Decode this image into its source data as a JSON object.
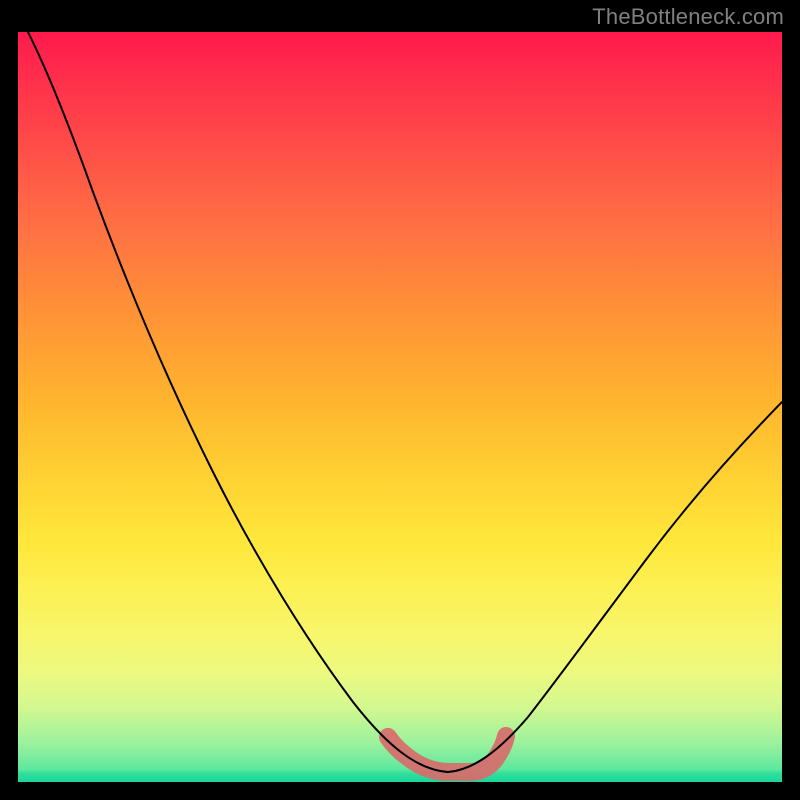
{
  "watermark": "TheBottleneck.com",
  "colors": {
    "frame_bg": "#000000",
    "curve_stroke": "#000000",
    "highlight_stroke": "#d86b6b",
    "gradient_top": "#ff1a4d",
    "gradient_bottom": "#17d79a"
  },
  "chart_data": {
    "type": "line",
    "title": "",
    "xlabel": "",
    "ylabel": "",
    "xlim": [
      0,
      100
    ],
    "ylim": [
      0,
      100
    ],
    "grid": false,
    "legend": false,
    "series": [
      {
        "name": "left-curve",
        "x": [
          0,
          3,
          7,
          12,
          18,
          24,
          30,
          36,
          42,
          46,
          50,
          53,
          56
        ],
        "y": [
          100,
          94,
          85,
          74,
          62,
          51,
          40,
          29,
          18,
          11,
          5,
          2,
          1
        ]
      },
      {
        "name": "right-curve",
        "x": [
          56,
          59,
          63,
          68,
          74,
          80,
          86,
          92,
          97,
          100
        ],
        "y": [
          1,
          2,
          5,
          10,
          17,
          25,
          33,
          41,
          47,
          51
        ]
      },
      {
        "name": "highlight-region",
        "x": [
          49,
          52,
          56,
          60,
          63
        ],
        "y": [
          4,
          1,
          1,
          1,
          4
        ]
      }
    ],
    "annotations": []
  }
}
